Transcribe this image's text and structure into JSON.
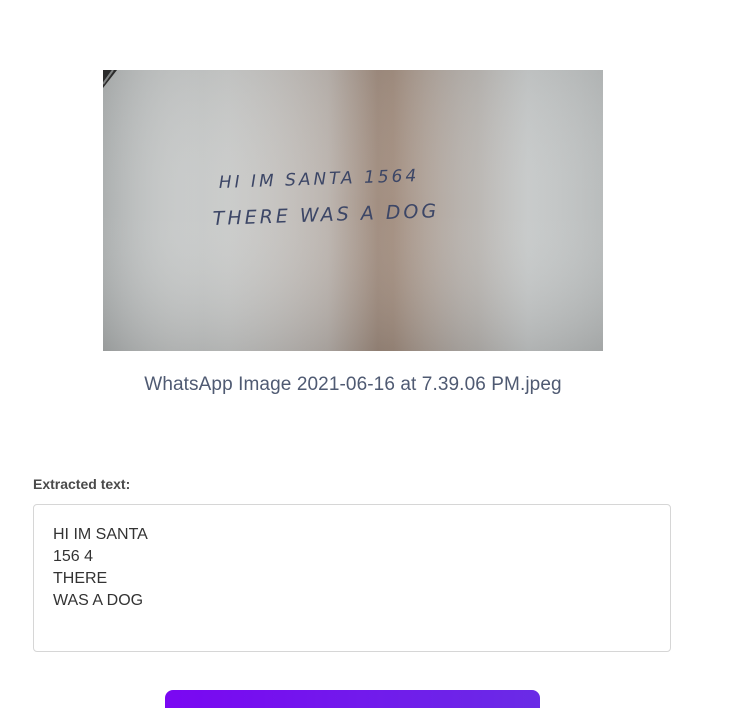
{
  "preview": {
    "image_alt": "handwritten-note-photo",
    "handwriting": {
      "line1": "HI IM SANTA 1564",
      "line2": "THERE WAS A DOG"
    },
    "filename": "WhatsApp Image 2021-06-16 at 7.39.06 PM.jpeg"
  },
  "result": {
    "label": "Extracted text:",
    "text": "HI IM SANTA\n156 4\nTHERE\nWAS A DOG"
  },
  "action": {
    "button_label": ""
  },
  "colors": {
    "accent": "#7a07f2",
    "filename_text": "#4f5a72",
    "label_text": "#4a4a4a",
    "border": "#d6d6d6"
  }
}
